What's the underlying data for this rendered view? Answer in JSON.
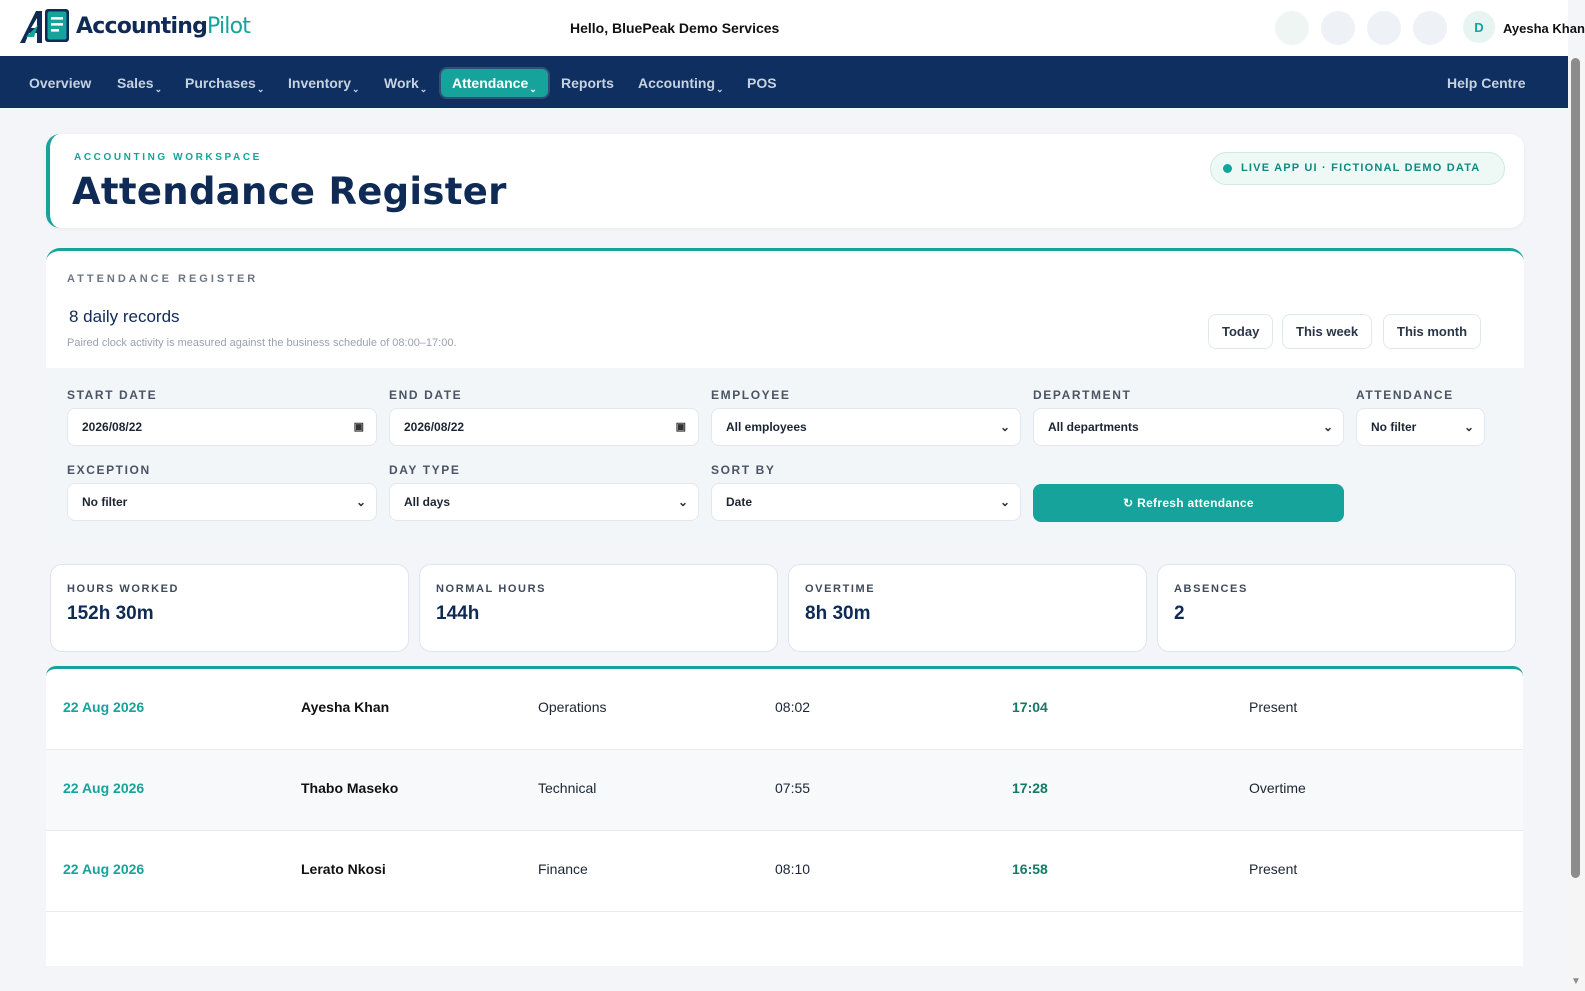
{
  "header": {
    "brand_main": "Accounting",
    "brand_accent": "Pilot",
    "greeting": "Hello, BluePeak Demo Services",
    "avatar_initial": "D",
    "user_name": "Ayesha Khan"
  },
  "nav": {
    "items": [
      {
        "label": "Overview",
        "dropdown": false
      },
      {
        "label": "Sales",
        "dropdown": true
      },
      {
        "label": "Purchases",
        "dropdown": true
      },
      {
        "label": "Inventory",
        "dropdown": true
      },
      {
        "label": "Work",
        "dropdown": true
      },
      {
        "label": "Attendance",
        "dropdown": true,
        "active": true
      },
      {
        "label": "Reports",
        "dropdown": false
      },
      {
        "label": "Accounting",
        "dropdown": true
      },
      {
        "label": "POS",
        "dropdown": false
      }
    ],
    "caret": "⌄",
    "help": "Help Centre"
  },
  "title_card": {
    "eyebrow": "ACCOUNTING WORKSPACE",
    "title": "Attendance Register",
    "badge": "LIVE APP UI · FICTIONAL DEMO DATA"
  },
  "register": {
    "section_label": "ATTENDANCE REGISTER",
    "record_count": "8 daily records",
    "schedule_note": "Paired clock activity is measured against the business schedule of 08:00–17:00.",
    "range_buttons": [
      "Today",
      "This week",
      "This month"
    ]
  },
  "filters": {
    "start_date": {
      "label": "START DATE",
      "value": "2026/08/22"
    },
    "end_date": {
      "label": "END DATE",
      "value": "2026/08/22"
    },
    "employee": {
      "label": "EMPLOYEE",
      "value": "All employees"
    },
    "department": {
      "label": "DEPARTMENT",
      "value": "All departments"
    },
    "attendance": {
      "label": "ATTENDANCE",
      "value": "No filter"
    },
    "exception": {
      "label": "EXCEPTION",
      "value": "No filter"
    },
    "day_type": {
      "label": "DAY TYPE",
      "value": "All days"
    },
    "sort_by": {
      "label": "SORT BY",
      "value": "Date"
    },
    "refresh_label": "Refresh attendance"
  },
  "stats": [
    {
      "label": "HOURS WORKED",
      "value": "152h 30m"
    },
    {
      "label": "NORMAL HOURS",
      "value": "144h"
    },
    {
      "label": "OVERTIME",
      "value": "8h 30m"
    },
    {
      "label": "ABSENCES",
      "value": "2"
    }
  ],
  "rows": [
    {
      "date": "22 Aug 2026",
      "name": "Ayesha Khan",
      "department": "Operations",
      "clock_in": "08:02",
      "clock_out": "17:04",
      "status": "Present"
    },
    {
      "date": "22 Aug 2026",
      "name": "Thabo Maseko",
      "department": "Technical",
      "clock_in": "07:55",
      "clock_out": "17:28",
      "status": "Overtime"
    },
    {
      "date": "22 Aug 2026",
      "name": "Lerato Nkosi",
      "department": "Finance",
      "clock_in": "08:10",
      "clock_out": "16:58",
      "status": "Present"
    }
  ],
  "colors": {
    "brand_navy": "#0e2f5f",
    "accent_teal": "#16a39b"
  },
  "icons": {
    "calendar": "calendar-icon",
    "chevron": "chevron-down-icon",
    "refresh": "refresh-icon"
  }
}
